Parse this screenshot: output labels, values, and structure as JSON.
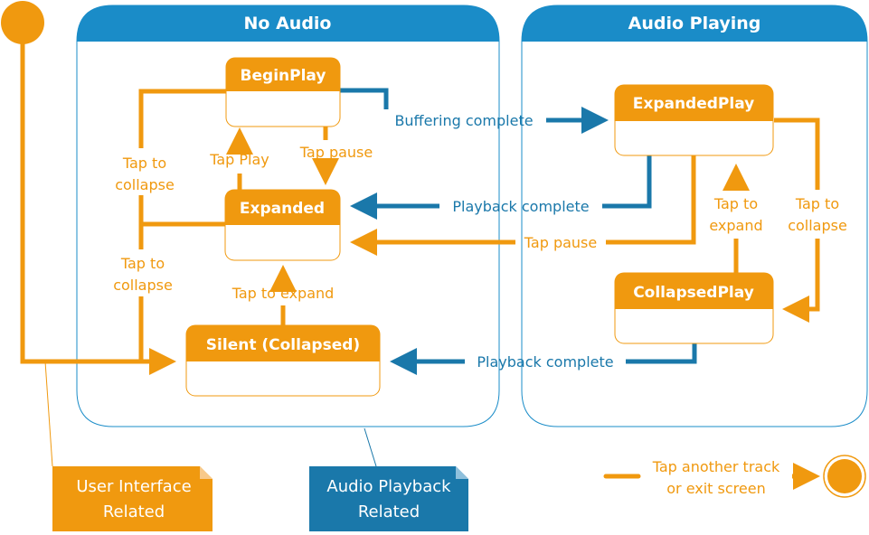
{
  "colors": {
    "ui_orange": "#f0990f",
    "playback_blue": "#1a78aa",
    "region_header_blue": "#1a8cc8"
  },
  "regions": {
    "no_audio": {
      "title": "No Audio"
    },
    "audio_playing": {
      "title": "Audio Playing"
    }
  },
  "states": {
    "begin_play": "BeginPlay",
    "expanded": "Expanded",
    "silent_collapsed": "Silent (Collapsed)",
    "expanded_play": "ExpandedPlay",
    "collapsed_play": "CollapsedPlay"
  },
  "transitions": {
    "buffering_complete": "Buffering complete",
    "playback_complete_expanded": "Playback complete",
    "tap_pause_to_expanded": "Tap pause",
    "playback_complete_silent": "Playback complete",
    "tap_play": "Tap Play",
    "tap_pause_begin": "Tap pause",
    "tap_to_expand_silent": "Tap to expand",
    "tap_to_collapse_begin": [
      "Tap to",
      "collapse"
    ],
    "tap_to_collapse_expanded": [
      "Tap to",
      "collapse"
    ],
    "tap_to_expand_play": [
      "Tap to",
      "expand"
    ],
    "tap_to_collapse_play": [
      "Tap to",
      "collapse"
    ],
    "exit": [
      "Tap another track",
      "or exit screen"
    ]
  },
  "notes": {
    "ui_related": [
      "User Interface",
      "Related"
    ],
    "audio_related": [
      "Audio Playback",
      "Related"
    ]
  },
  "symbols": {
    "initial": "initial-state-icon",
    "final": "final-state-icon"
  }
}
